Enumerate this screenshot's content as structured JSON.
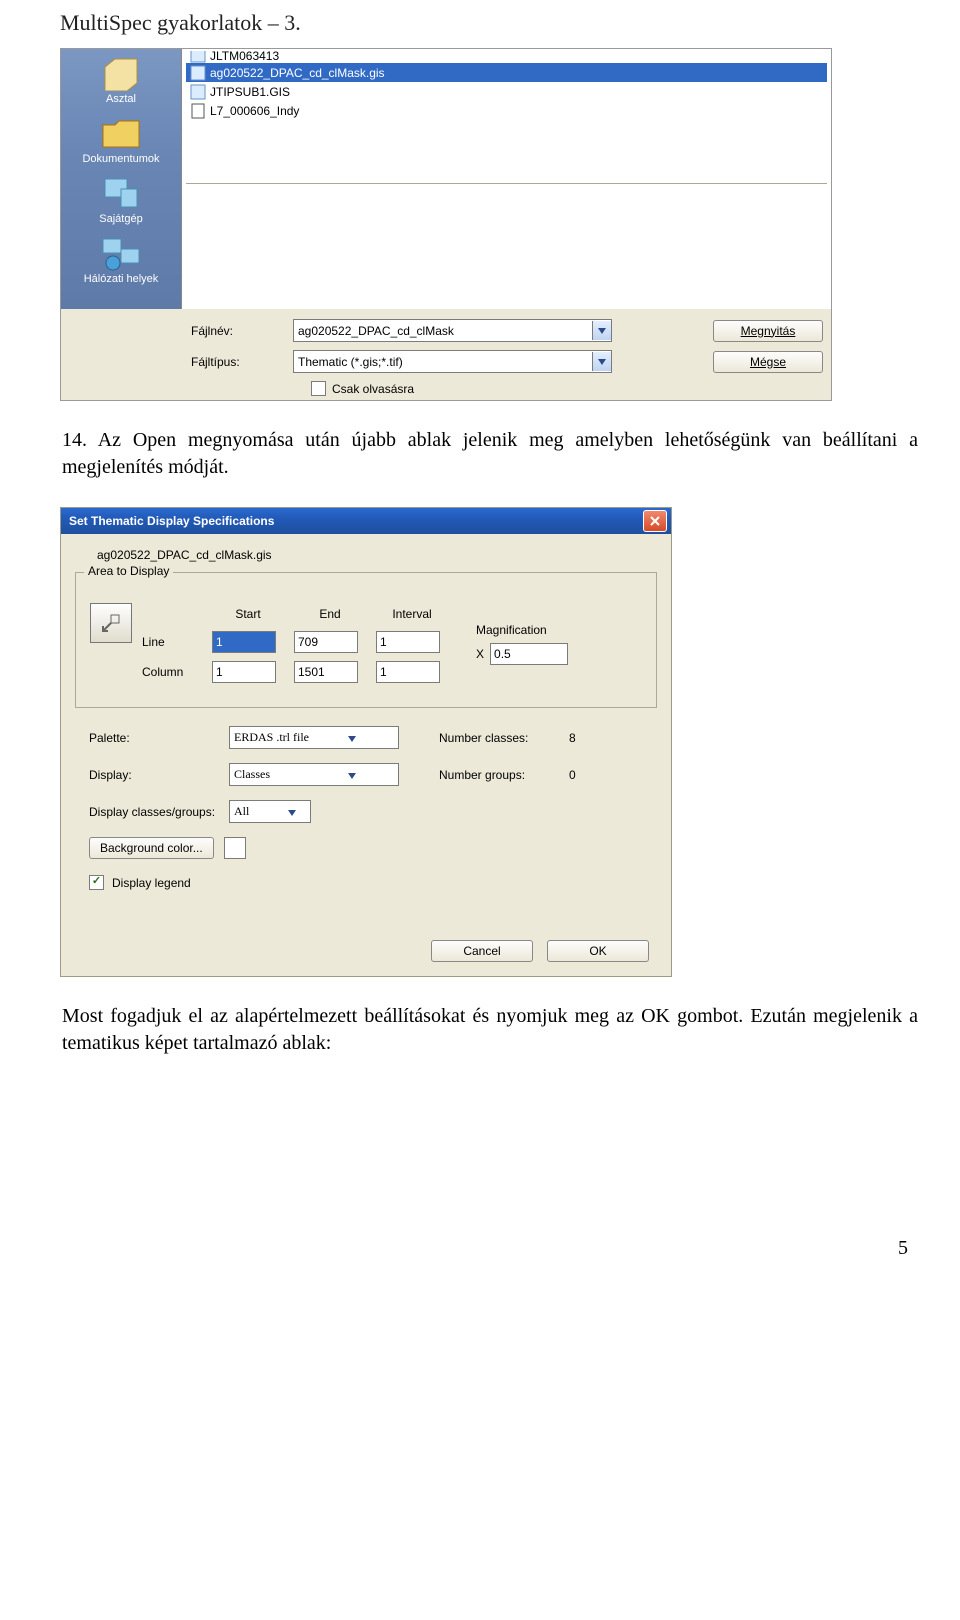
{
  "doc": {
    "header": "MultiSpec gyakorlatok – 3.",
    "para1": "14. Az Open megnyomása után újabb ablak jelenik meg amelyben lehetőségünk van beállítani a megjelenítés módját.",
    "para2": "Most fogadjuk el az alapértelmezett beállításokat és nyomjuk meg az OK gombot. Ezután megjelenik a tematikus képet tartalmazó ablak:",
    "page_number": "5"
  },
  "open_dialog": {
    "places": {
      "desktop": "Asztal",
      "documents": "Dokumentumok",
      "computer": "Sajátgép",
      "network": "Hálózati helyek"
    },
    "files": {
      "top_cut": "JLTM063413",
      "selected": "ag020522_DPAC_cd_clMask.gis",
      "item2": "JTIPSUB1.GIS",
      "item3": "L7_000606_Indy"
    },
    "labels": {
      "filename": "Fájlnév:",
      "filetype": "Fájltípus:",
      "readonly": "Csak olvasásra"
    },
    "values": {
      "filename": "ag020522_DPAC_cd_clMask",
      "filetype": "Thematic (*.gis;*.tif)"
    },
    "buttons": {
      "open": "Megnyitás",
      "cancel": "Mégse"
    }
  },
  "thematic_dialog": {
    "title": "Set Thematic Display Specifications",
    "filename": "ag020522_DPAC_cd_clMask.gis",
    "groupbox_title": "Area to Display",
    "headers": {
      "start": "Start",
      "end": "End",
      "interval": "Interval"
    },
    "row_labels": {
      "line": "Line",
      "column": "Column"
    },
    "values": {
      "line_start": "1",
      "line_end": "709",
      "line_interval": "1",
      "col_start": "1",
      "col_end": "1501",
      "col_interval": "1",
      "magnification_label": "Magnification",
      "mag_x": "X",
      "mag_value": "0.5"
    },
    "mid": {
      "palette_label": "Palette:",
      "palette_value": "ERDAS .trl file",
      "display_label": "Display:",
      "display_value": "Classes",
      "dcg_label": "Display classes/groups:",
      "dcg_value": "All",
      "num_classes_label": "Number classes:",
      "num_classes_value": "8",
      "num_groups_label": "Number groups:",
      "num_groups_value": "0",
      "bgcolor_btn": "Background color...",
      "disp_legend": "Display legend"
    },
    "actions": {
      "cancel": "Cancel",
      "ok": "OK"
    }
  }
}
